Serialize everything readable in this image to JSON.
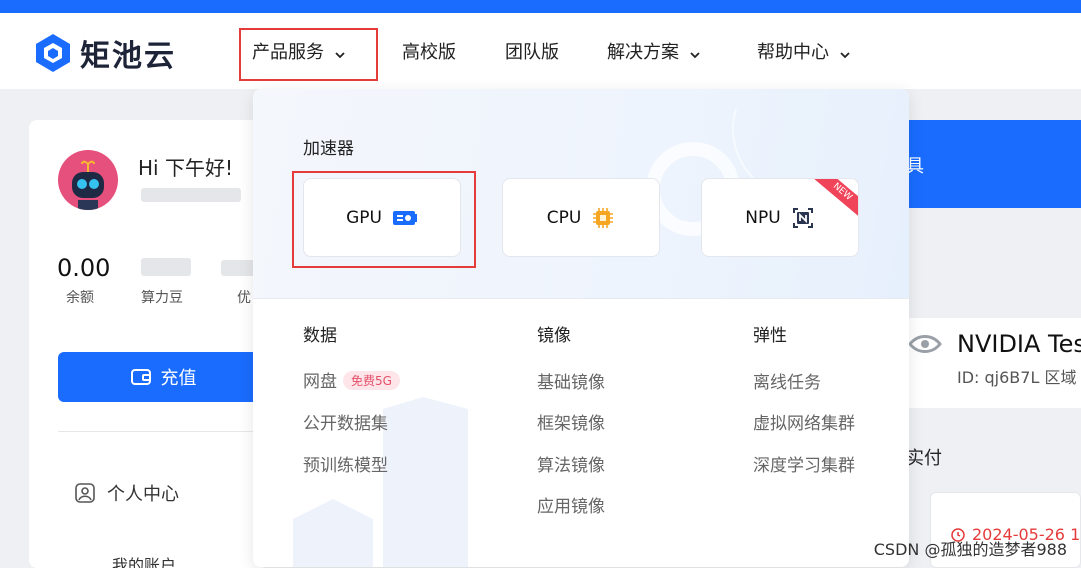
{
  "brand": {
    "name": "矩池云",
    "color": "#1a6cff"
  },
  "nav": {
    "items": [
      {
        "label": "产品服务",
        "has_menu": true
      },
      {
        "label": "高校版",
        "has_menu": false
      },
      {
        "label": "团队版",
        "has_menu": false
      },
      {
        "label": "解决方案",
        "has_menu": true
      },
      {
        "label": "帮助中心",
        "has_menu": true
      }
    ]
  },
  "dropdown": {
    "section_title": "加速器",
    "accelerators": [
      {
        "label": "GPU",
        "icon": "gpu-card-icon"
      },
      {
        "label": "CPU",
        "icon": "cpu-chip-icon"
      },
      {
        "label": "NPU",
        "icon": "npu-icon",
        "ribbon": "NEW"
      }
    ],
    "columns": [
      {
        "title": "数据",
        "items": [
          {
            "label": "网盘",
            "badge": "免费5G"
          },
          {
            "label": "公开数据集"
          },
          {
            "label": "预训练模型"
          }
        ]
      },
      {
        "title": "镜像",
        "items": [
          {
            "label": "基础镜像"
          },
          {
            "label": "框架镜像"
          },
          {
            "label": "算法镜像"
          },
          {
            "label": "应用镜像"
          }
        ]
      },
      {
        "title": "弹性",
        "items": [
          {
            "label": "离线任务"
          },
          {
            "label": "虚拟网络集群"
          },
          {
            "label": "深度学习集群"
          }
        ]
      }
    ]
  },
  "left_panel": {
    "greeting": "Hi 下午好!",
    "balance": "0.00",
    "stats": [
      {
        "label": "余额"
      },
      {
        "label": "算力豆"
      },
      {
        "label": "优"
      }
    ],
    "recharge_label": "充值",
    "menu": {
      "personal_center": "个人中心",
      "my_account": "我的账户"
    }
  },
  "right_panel": {
    "banner_text": "具",
    "gpu_name": "NVIDIA Tes",
    "gpu_id": "ID: qj6B7L  区域",
    "section_label": "实付",
    "date": "2024-05-26 1"
  },
  "watermark": "CSDN @孤独的造梦者988"
}
